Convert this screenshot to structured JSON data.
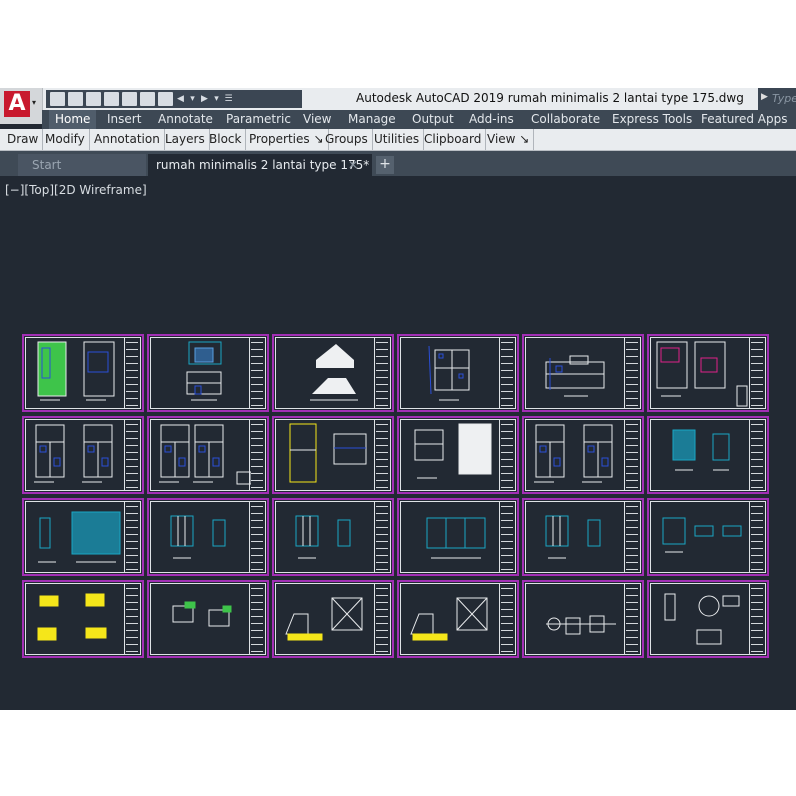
{
  "window": {
    "title": "Autodesk AutoCAD 2019    rumah minimalis 2 lantai type 175.dwg"
  },
  "app_menu": {
    "logo": "A"
  },
  "search": {
    "placeholder": "Type"
  },
  "ribbon_tabs": [
    "Home",
    "Insert",
    "Annotate",
    "Parametric",
    "View",
    "Manage",
    "Output",
    "Add-ins",
    "Collaborate",
    "Express Tools",
    "Featured Apps"
  ],
  "active_ribbon_tab": "Home",
  "ribbon_panels": [
    "Draw",
    "Modify",
    "Annotation",
    "Layers",
    "Block",
    "Properties ↘",
    "Groups",
    "Utilities",
    "Clipboard",
    "View ↘"
  ],
  "doc_tabs": {
    "start": "Start",
    "active": "rumah minimalis 2 lantai type 175*",
    "close": "✕",
    "add": "+"
  },
  "viewport": {
    "controls": "[−][Top][2D Wireframe]"
  },
  "sheets": [
    {
      "kind": "site-plan"
    },
    {
      "kind": "facade"
    },
    {
      "kind": "section-white"
    },
    {
      "kind": "section"
    },
    {
      "kind": "section-wide"
    },
    {
      "kind": "plan-red"
    },
    {
      "kind": "plan"
    },
    {
      "kind": "plan-legend"
    },
    {
      "kind": "plan-yellow"
    },
    {
      "kind": "plan-white"
    },
    {
      "kind": "plan"
    },
    {
      "kind": "detail-cyan"
    },
    {
      "kind": "detail-cyan-big"
    },
    {
      "kind": "detail-frames"
    },
    {
      "kind": "detail-frames"
    },
    {
      "kind": "detail-wide"
    },
    {
      "kind": "detail-frames"
    },
    {
      "kind": "detail-small"
    },
    {
      "kind": "yellow-details"
    },
    {
      "kind": "detail-green"
    },
    {
      "kind": "structure"
    },
    {
      "kind": "structure"
    },
    {
      "kind": "detail-white"
    },
    {
      "kind": "detail-white2"
    }
  ],
  "colors": {
    "sheet_border": "#a22fb5",
    "model_bg": "#222933",
    "ribbon_bg": "#3d4854"
  }
}
